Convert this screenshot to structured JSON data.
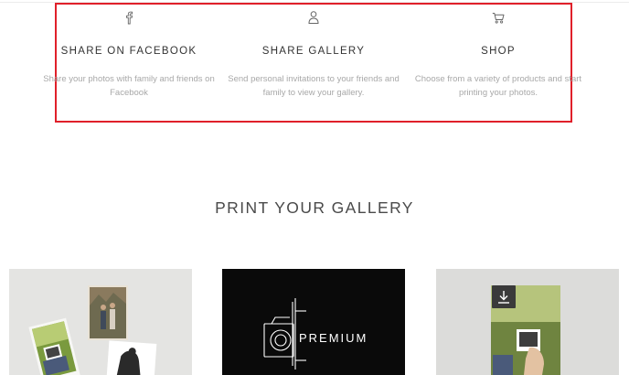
{
  "features": [
    {
      "icon": "facebook-icon",
      "title": "SHARE ON FACEBOOK",
      "description": "Share your photos with family and friends on Facebook"
    },
    {
      "icon": "user-icon",
      "title": "SHARE GALLERY",
      "description": "Send personal invitations to your friends and family to view your gallery."
    },
    {
      "icon": "cart-icon",
      "title": "SHOP",
      "description": "Choose from a variety of products and start printing your photos."
    }
  ],
  "highlight_color": "#e0202a",
  "print_section": {
    "title": "PRINT YOUR GALLERY",
    "cards": [
      {
        "kind": "photo-collage"
      },
      {
        "kind": "premium",
        "label": "PREMIUM"
      },
      {
        "kind": "photo",
        "action_icon": "download-icon"
      }
    ]
  }
}
